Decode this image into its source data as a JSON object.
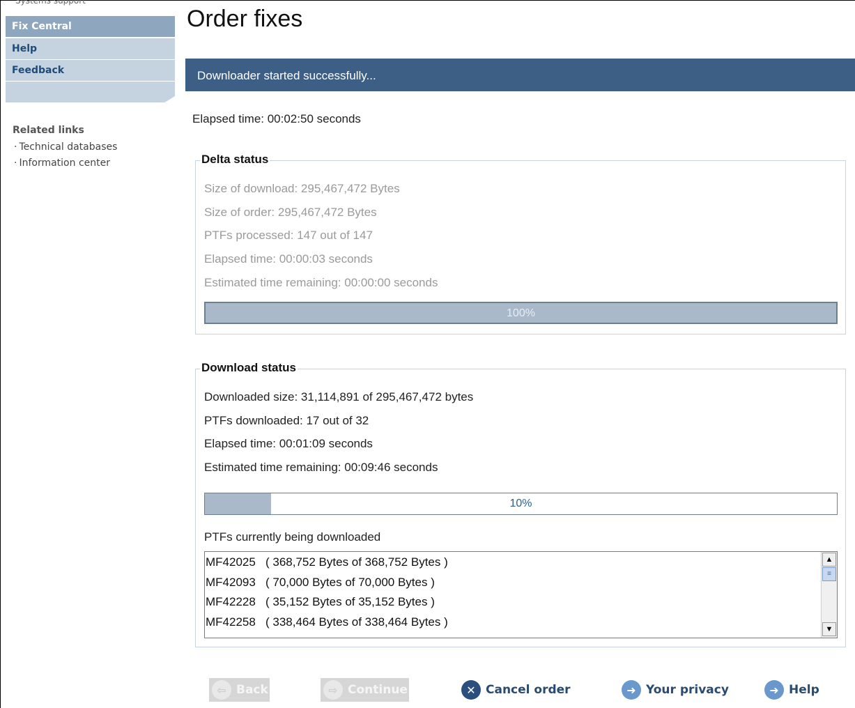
{
  "sidebar": {
    "crumb_fragment": "Systems support",
    "items": [
      {
        "label": "Fix Central"
      },
      {
        "label": "Help"
      },
      {
        "label": "Feedback"
      }
    ],
    "related_title": "Related links",
    "related_links": [
      "Technical databases",
      "Information center"
    ]
  },
  "main": {
    "title": "Order fixes",
    "banner": "Downloader started successfully...",
    "elapsed": "Elapsed time: 00:02:50 seconds",
    "delta": {
      "legend": "Delta status",
      "lines": [
        "Size of download: 295,467,472 Bytes",
        "Size of order: 295,467,472 Bytes",
        "PTFs processed: 147 out of 147",
        "Elapsed time: 00:00:03 seconds",
        "Estimated time remaining: 00:00:00 seconds"
      ],
      "progress_label": "100%",
      "progress_value": 1.0
    },
    "download": {
      "legend": "Download status",
      "lines": [
        "Downloaded size: 31,114,891 of 295,467,472 bytes",
        "PTFs downloaded: 17 out of 32",
        "Elapsed time: 00:01:09 seconds",
        "Estimated time remaining: 00:09:46 seconds"
      ],
      "progress_label": "10%",
      "progress_value": 0.105,
      "list_label": "PTFs currently being downloaded",
      "ptfs": [
        "MF42025   ( 368,752 Bytes of 368,752 Bytes )",
        "MF42093   ( 70,000 Bytes of 70,000 Bytes )",
        "MF42228   ( 35,152 Bytes of 35,152 Bytes )",
        "MF42258   ( 338,464 Bytes of 338,464 Bytes )"
      ]
    }
  },
  "buttons": {
    "back": "Back",
    "continue": "Continue",
    "cancel": "Cancel order",
    "privacy": "Your privacy",
    "help": "Help"
  },
  "icons": {
    "back": "arrow-left-icon",
    "continue": "arrow-right-icon",
    "cancel": "close-icon",
    "privacy": "arrow-right-icon",
    "help": "arrow-right-icon",
    "scroll_up": "triangle-up-icon",
    "scroll_down": "triangle-down-icon"
  },
  "colors": {
    "banner": "#3d5e85",
    "nav_active": "#8ea6be",
    "nav_item": "#c5d3e0",
    "progress_fill": "#a9b9c9"
  }
}
